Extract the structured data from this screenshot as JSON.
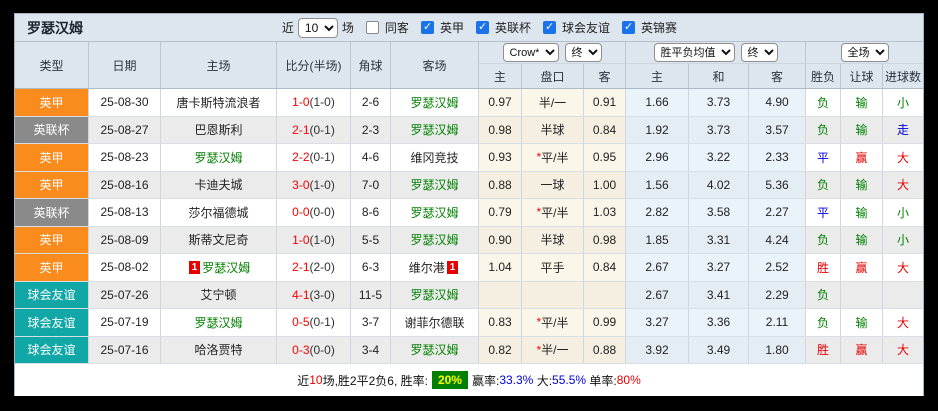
{
  "title": {
    "team": "罗瑟汉姆"
  },
  "filter": {
    "near": "近",
    "count": "10",
    "unit": "场",
    "same_away": "同客",
    "leagues": [
      "英甲",
      "英联杯",
      "球会友谊",
      "英锦赛"
    ]
  },
  "selects": {
    "bookmaker": "Crow*",
    "bookmaker_stage": "终",
    "euro": "胜平负均值",
    "euro_stage": "终",
    "scope": "全场"
  },
  "headers": {
    "type": "类型",
    "date": "日期",
    "home": "主场",
    "score": "比分(半场)",
    "corner": "角球",
    "away": "客场",
    "ah_home": "主",
    "ah_line": "盘口",
    "ah_away": "客",
    "eu_home": "主",
    "eu_draw": "和",
    "eu_away": "客",
    "result": "胜负",
    "handicap": "让球",
    "goals": "进球数"
  },
  "colors": {
    "league_one": "#fa8c1e",
    "league_cup": "#8a8a8a",
    "friendly": "#12a7a7",
    "win_text": "#e60000",
    "draw_text": "#0000dd",
    "lose_text": "#008000",
    "score_red": "#ff0000",
    "team_green": "#008000",
    "header_bg": "#dde6ee",
    "rate_badge_bg": "#008000",
    "rate_badge_text": "#ffff00"
  },
  "rows": [
    {
      "league": "英甲",
      "league_cls": "lg-orange",
      "date": "25-08-30",
      "home": "唐卡斯特流浪者",
      "home_cls": "",
      "home_card": "",
      "score_ft": "1-0",
      "score_ht": "(1-0)",
      "corner": "2-6",
      "away": "罗瑟汉姆",
      "away_cls": "green",
      "away_card": "",
      "ah_star": "",
      "ah_h": "0.97",
      "ah_line": "半/一",
      "ah_a": "0.91",
      "eu_h": "1.66",
      "eu_d": "3.73",
      "eu_a": "4.90",
      "res": "负",
      "res_cls": "t-green",
      "let": "输",
      "let_cls": "t-green",
      "goal": "小",
      "goal_cls": "t-green"
    },
    {
      "league": "英联杯",
      "league_cls": "lg-gray",
      "date": "25-08-27",
      "home": "巴恩斯利",
      "home_cls": "",
      "home_card": "",
      "score_ft": "2-1",
      "score_ht": "(0-1)",
      "corner": "2-3",
      "away": "罗瑟汉姆",
      "away_cls": "green",
      "away_card": "",
      "ah_star": "",
      "ah_h": "0.98",
      "ah_line": "半球",
      "ah_a": "0.84",
      "eu_h": "1.92",
      "eu_d": "3.73",
      "eu_a": "3.57",
      "res": "负",
      "res_cls": "t-green",
      "let": "输",
      "let_cls": "t-green",
      "goal": "走",
      "goal_cls": "t-blue"
    },
    {
      "league": "英甲",
      "league_cls": "lg-orange",
      "date": "25-08-23",
      "home": "罗瑟汉姆",
      "home_cls": "green",
      "home_card": "",
      "score_ft": "2-2",
      "score_ht": "(0-1)",
      "corner": "4-6",
      "away": "维冈竞技",
      "away_cls": "",
      "away_card": "",
      "ah_star": "*",
      "ah_h": "0.93",
      "ah_line": "平/半",
      "ah_a": "0.95",
      "eu_h": "2.96",
      "eu_d": "3.22",
      "eu_a": "2.33",
      "res": "平",
      "res_cls": "t-blue",
      "let": "赢",
      "let_cls": "t-red",
      "goal": "大",
      "goal_cls": "t-red"
    },
    {
      "league": "英甲",
      "league_cls": "lg-orange",
      "date": "25-08-16",
      "home": "卡迪夫城",
      "home_cls": "",
      "home_card": "",
      "score_ft": "3-0",
      "score_ht": "(1-0)",
      "corner": "7-0",
      "away": "罗瑟汉姆",
      "away_cls": "green",
      "away_card": "",
      "ah_star": "",
      "ah_h": "0.88",
      "ah_line": "一球",
      "ah_a": "1.00",
      "eu_h": "1.56",
      "eu_d": "4.02",
      "eu_a": "5.36",
      "res": "负",
      "res_cls": "t-green",
      "let": "输",
      "let_cls": "t-green",
      "goal": "大",
      "goal_cls": "t-red"
    },
    {
      "league": "英联杯",
      "league_cls": "lg-gray",
      "date": "25-08-13",
      "home": "莎尔福德城",
      "home_cls": "",
      "home_card": "",
      "score_ft": "0-0",
      "score_ht": "(0-0)",
      "corner": "8-6",
      "away": "罗瑟汉姆",
      "away_cls": "green",
      "away_card": "",
      "ah_star": "*",
      "ah_h": "0.79",
      "ah_line": "平/半",
      "ah_a": "1.03",
      "eu_h": "2.82",
      "eu_d": "3.58",
      "eu_a": "2.27",
      "res": "平",
      "res_cls": "t-blue",
      "let": "输",
      "let_cls": "t-green",
      "goal": "小",
      "goal_cls": "t-green"
    },
    {
      "league": "英甲",
      "league_cls": "lg-orange",
      "date": "25-08-09",
      "home": "斯蒂文尼奇",
      "home_cls": "",
      "home_card": "",
      "score_ft": "1-0",
      "score_ht": "(1-0)",
      "corner": "5-5",
      "away": "罗瑟汉姆",
      "away_cls": "green",
      "away_card": "",
      "ah_star": "",
      "ah_h": "0.90",
      "ah_line": "半球",
      "ah_a": "0.98",
      "eu_h": "1.85",
      "eu_d": "3.31",
      "eu_a": "4.24",
      "res": "负",
      "res_cls": "t-green",
      "let": "输",
      "let_cls": "t-green",
      "goal": "小",
      "goal_cls": "t-green"
    },
    {
      "league": "英甲",
      "league_cls": "lg-orange",
      "date": "25-08-02",
      "home": "罗瑟汉姆",
      "home_cls": "green",
      "home_card": "1",
      "score_ft": "2-1",
      "score_ht": "(2-0)",
      "corner": "6-3",
      "away": "维尔港",
      "away_cls": "",
      "away_card": "1",
      "ah_star": "",
      "ah_h": "1.04",
      "ah_line": "平手",
      "ah_a": "0.84",
      "eu_h": "2.67",
      "eu_d": "3.27",
      "eu_a": "2.52",
      "res": "胜",
      "res_cls": "t-red",
      "let": "赢",
      "let_cls": "t-red",
      "goal": "大",
      "goal_cls": "t-red"
    },
    {
      "league": "球会友谊",
      "league_cls": "lg-teal",
      "date": "25-07-26",
      "home": "艾宁顿",
      "home_cls": "",
      "home_card": "",
      "score_ft": "4-1",
      "score_ht": "(3-0)",
      "corner": "11-5",
      "away": "罗瑟汉姆",
      "away_cls": "green",
      "away_card": "",
      "ah_star": "",
      "ah_h": "",
      "ah_line": "",
      "ah_a": "",
      "eu_h": "2.67",
      "eu_d": "3.41",
      "eu_a": "2.29",
      "res": "负",
      "res_cls": "t-green",
      "let": "",
      "let_cls": "",
      "goal": "",
      "goal_cls": ""
    },
    {
      "league": "球会友谊",
      "league_cls": "lg-teal",
      "date": "25-07-19",
      "home": "罗瑟汉姆",
      "home_cls": "green",
      "home_card": "",
      "score_ft": "0-5",
      "score_ht": "(0-1)",
      "corner": "3-7",
      "away": "谢菲尔德联",
      "away_cls": "",
      "away_card": "",
      "ah_star": "*",
      "ah_h": "0.83",
      "ah_line": "平/半",
      "ah_a": "0.99",
      "eu_h": "3.27",
      "eu_d": "3.36",
      "eu_a": "2.11",
      "res": "负",
      "res_cls": "t-green",
      "let": "输",
      "let_cls": "t-green",
      "goal": "大",
      "goal_cls": "t-red"
    },
    {
      "league": "球会友谊",
      "league_cls": "lg-teal",
      "date": "25-07-16",
      "home": "哈洛贾特",
      "home_cls": "",
      "home_card": "",
      "score_ft": "0-3",
      "score_ht": "(0-0)",
      "corner": "3-4",
      "away": "罗瑟汉姆",
      "away_cls": "green",
      "away_card": "",
      "ah_star": "*",
      "ah_h": "0.82",
      "ah_line": "半/一",
      "ah_a": "0.88",
      "eu_h": "3.92",
      "eu_d": "3.49",
      "eu_a": "1.80",
      "res": "胜",
      "res_cls": "t-red",
      "let": "赢",
      "let_cls": "t-red",
      "goal": "大",
      "goal_cls": "t-red"
    }
  ],
  "footer": {
    "near": "近",
    "count": "10",
    "mid": "场,胜2平2负6, 胜率:",
    "win_badge": "20%",
    "win_label": "赢率:",
    "win_pct": "33.3%",
    "big_label": " 大:",
    "big_pct": "55.5%",
    "single_label": " 单率:",
    "single_pct": "80%"
  }
}
